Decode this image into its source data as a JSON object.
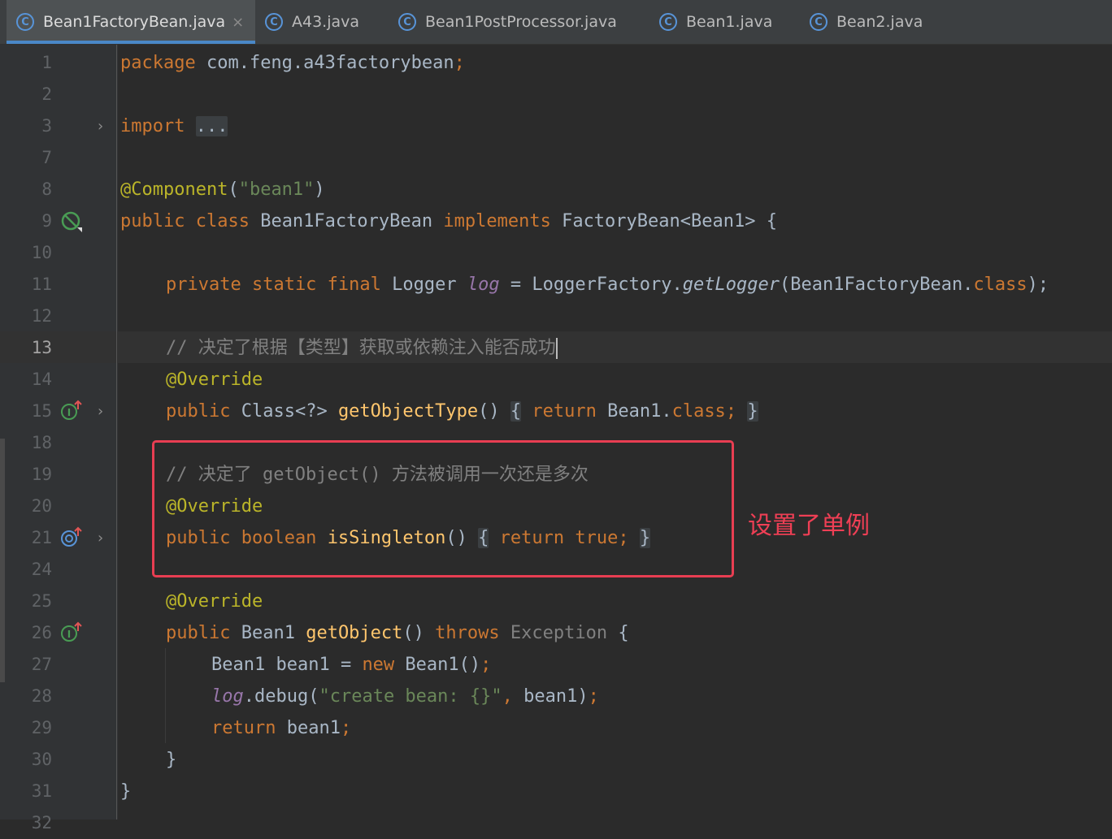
{
  "tabs": [
    {
      "label": "Bean1FactoryBean.java",
      "active": true
    },
    {
      "label": "A43.java"
    },
    {
      "label": "Bean1PostProcessor.java"
    },
    {
      "label": "Bean1.java"
    },
    {
      "label": "Bean2.java"
    }
  ],
  "tab_close_glyph": "×",
  "tab_icon_letter": "C",
  "line_numbers": [
    "1",
    "2",
    "3",
    "7",
    "8",
    "9",
    "10",
    "11",
    "12",
    "13",
    "14",
    "15",
    "18",
    "19",
    "20",
    "21",
    "24",
    "25",
    "26",
    "27",
    "28",
    "29",
    "30",
    "31",
    "32"
  ],
  "code": {
    "l1": {
      "kw": "package",
      "rest": " com.feng.a43factorybean",
      "semi": ";"
    },
    "l3": {
      "kw": "import",
      "fold": "..."
    },
    "l8": {
      "ann": "@Component",
      "open": "(",
      "str": "\"bean1\"",
      "close": ")"
    },
    "l9": {
      "kw1": "public class",
      "name": " Bean1FactoryBean ",
      "kw2": "implements",
      "rest": " FactoryBean<Bean1> {"
    },
    "l11": {
      "kw": "private static final",
      "type": " Logger ",
      "field": "log",
      "eq": " = LoggerFactory.",
      "method": "getLogger",
      "args": "(Bean1FactoryBean.",
      "kw2": "class",
      "end": ");"
    },
    "l13": {
      "comment": "// 决定了根据【类型】获取或依赖注入能否成功"
    },
    "l14": {
      "ann": "@Override"
    },
    "l15": {
      "kw": "public",
      "type": " Class<?> ",
      "fn": "getObjectType",
      "paren": "()",
      "ob": "{",
      "sp": " ",
      "kw2": "return",
      "rest": " Bean1.",
      "kw3": "class",
      "semi": ";",
      "cb": "}"
    },
    "l19": {
      "comment": "// 决定了 getObject() 方法被调用一次还是多次"
    },
    "l20": {
      "ann": "@Override"
    },
    "l21": {
      "kw": "public boolean",
      "fn": "isSingleton",
      "paren": "()",
      "ob": "{",
      "kw2": "return true",
      "semi": ";",
      "cb": "}"
    },
    "l25": {
      "ann": "@Override"
    },
    "l26": {
      "kw": "public",
      "type": " Bean1 ",
      "fn": "getObject",
      "paren": "()",
      "kw2": "throws",
      "exc": " Exception",
      "brace": " {"
    },
    "l27": {
      "text": "Bean1 bean1 = ",
      "kw": "new",
      "rest": " Bean1()",
      "semi": ";"
    },
    "l28": {
      "field": "log",
      "call": ".debug(",
      "str": "\"create bean: {}\"",
      "comma": ",",
      "rest": " bean1)",
      "semi": ";"
    },
    "l29": {
      "kw": "return",
      "rest": " bean1",
      "semi": ";"
    },
    "l30": {
      "text": "}"
    },
    "l31": {
      "text": "}"
    }
  },
  "annotation_note": "设置了单例",
  "colors": {
    "highlight": "#e83e52",
    "keyword": "#cc7832",
    "annotation": "#bbb529",
    "string": "#6a8759",
    "function": "#ffc66d",
    "comment": "#808080"
  }
}
